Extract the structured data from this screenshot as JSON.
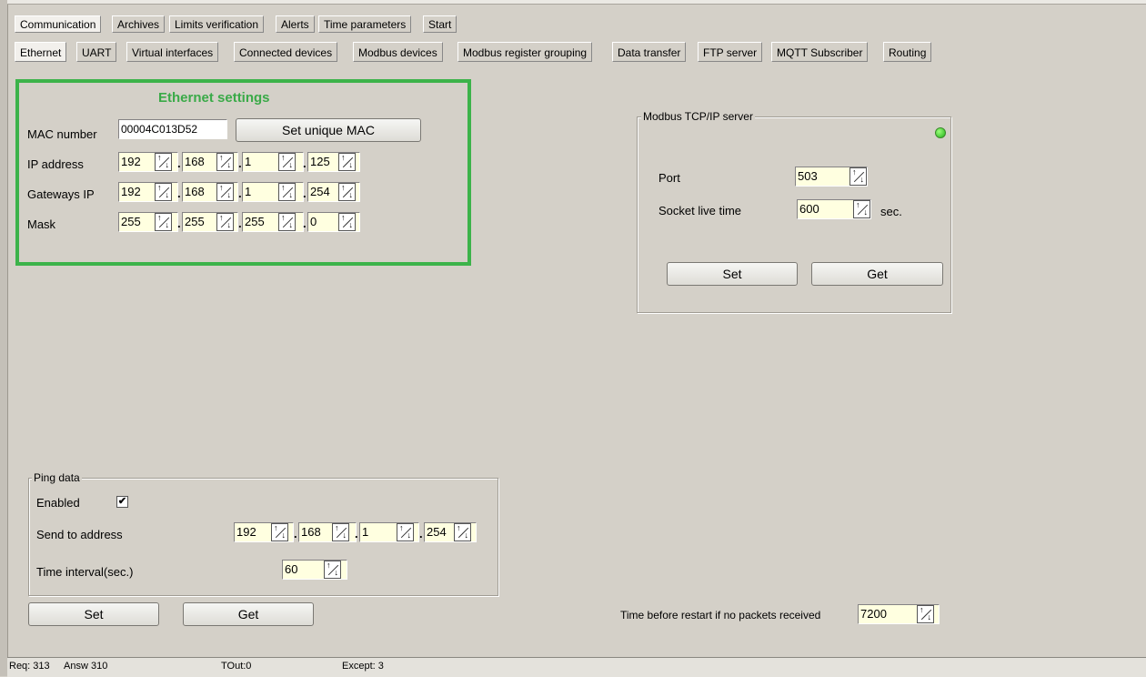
{
  "top_tabs": [
    "Communication",
    "Archives",
    "Limits verification",
    "Alerts",
    "Time parameters",
    "Start"
  ],
  "sub_tabs": [
    "Ethernet",
    "UART",
    "Virtual interfaces",
    "Connected devices",
    "Modbus devices",
    "Modbus register grouping",
    "Data transfer",
    "FTP server",
    "MQTT Subscriber",
    "Routing"
  ],
  "ethernet": {
    "title": "Ethernet settings",
    "mac_label": "MAC number",
    "mac_value": "00004C013D52",
    "set_mac_button": "Set unique MAC",
    "ip_label": "IP address",
    "ip": [
      "192",
      "168",
      "1",
      "125"
    ],
    "gateway_label": "Gateways IP",
    "gateway": [
      "192",
      "168",
      "1",
      "254"
    ],
    "mask_label": "Mask",
    "mask": [
      "255",
      "255",
      "255",
      "0"
    ]
  },
  "modbus": {
    "title": "Modbus TCP/IP server",
    "port_label": "Port",
    "port_value": "503",
    "socket_label": "Socket live time",
    "socket_value": "600",
    "socket_unit": "sec.",
    "set_button": "Set",
    "get_button": "Get",
    "status_color": "#22b11a"
  },
  "ping": {
    "title": "Ping data",
    "enabled_label": "Enabled",
    "enabled_mark": "✔",
    "send_label": "Send to address",
    "address": [
      "192",
      "168",
      "1",
      "254"
    ],
    "interval_label": "Time interval(sec.)",
    "interval_value": "60",
    "set_button": "Set",
    "get_button": "Get"
  },
  "restart": {
    "label": "Time before restart if no packets received",
    "value": "7200"
  },
  "status_bar": {
    "req": "Req: 313",
    "answ": "Answ   310",
    "tout": "TOut:0",
    "except": "Except:  3"
  }
}
